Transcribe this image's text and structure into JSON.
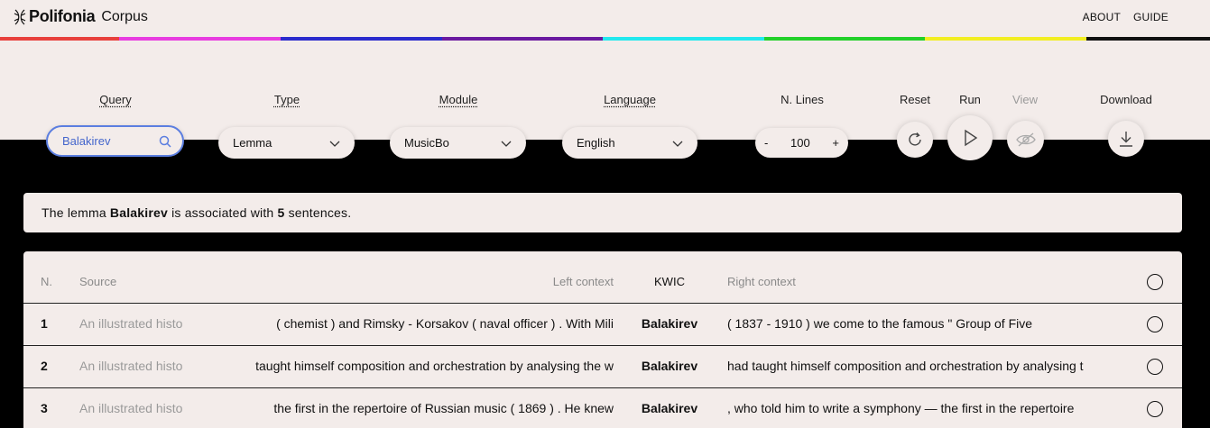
{
  "brand": {
    "name": "Polifonia",
    "sub": "Corpus"
  },
  "nav": [
    "ABOUT",
    "GUIDE"
  ],
  "stripe_colors": [
    "#e8403c",
    "#e83ce0",
    "#2a2acc",
    "#6a1aa0",
    "#22e8ee",
    "#22d02a",
    "#f2ee22",
    "#111111"
  ],
  "controls": {
    "query": {
      "label": "Query",
      "value": "Balakirev"
    },
    "type": {
      "label": "Type",
      "value": "Lemma"
    },
    "module": {
      "label": "Module",
      "value": "MusicBo"
    },
    "language": {
      "label": "Language",
      "value": "English"
    },
    "nlines": {
      "label": "N. Lines",
      "value": "100",
      "minus": "-",
      "plus": "+"
    },
    "reset": {
      "label": "Reset"
    },
    "run": {
      "label": "Run"
    },
    "view": {
      "label": "View"
    },
    "download": {
      "label": "Download"
    }
  },
  "info": {
    "pre": "The lemma ",
    "lemma": "Balakirev",
    "mid": " is associated with ",
    "count": "5",
    "post": " sentences."
  },
  "table": {
    "headers": {
      "n": "N.",
      "source": "Source",
      "left": "Left context",
      "kwic": "KWIC",
      "right": "Right context"
    },
    "rows": [
      {
        "n": "1",
        "source": "An illustrated histo",
        "left": "( chemist ) and Rimsky - Korsakov ( naval officer ) . With Mili",
        "kwic": "Balakirev",
        "right": "( 1837 - 1910 ) we come to the famous \" Group of Five"
      },
      {
        "n": "2",
        "source": "An illustrated histo",
        "left": "taught himself composition and orchestration by analysing the w",
        "kwic": "Balakirev",
        "right": "had taught himself composition and orchestration by analysing t"
      },
      {
        "n": "3",
        "source": "An illustrated histo",
        "left": "the first in the repertoire of Russian music ( 1869 ) . He knew",
        "kwic": "Balakirev",
        "right": ", who told him to write a symphony — the first in the repertoire"
      }
    ]
  }
}
